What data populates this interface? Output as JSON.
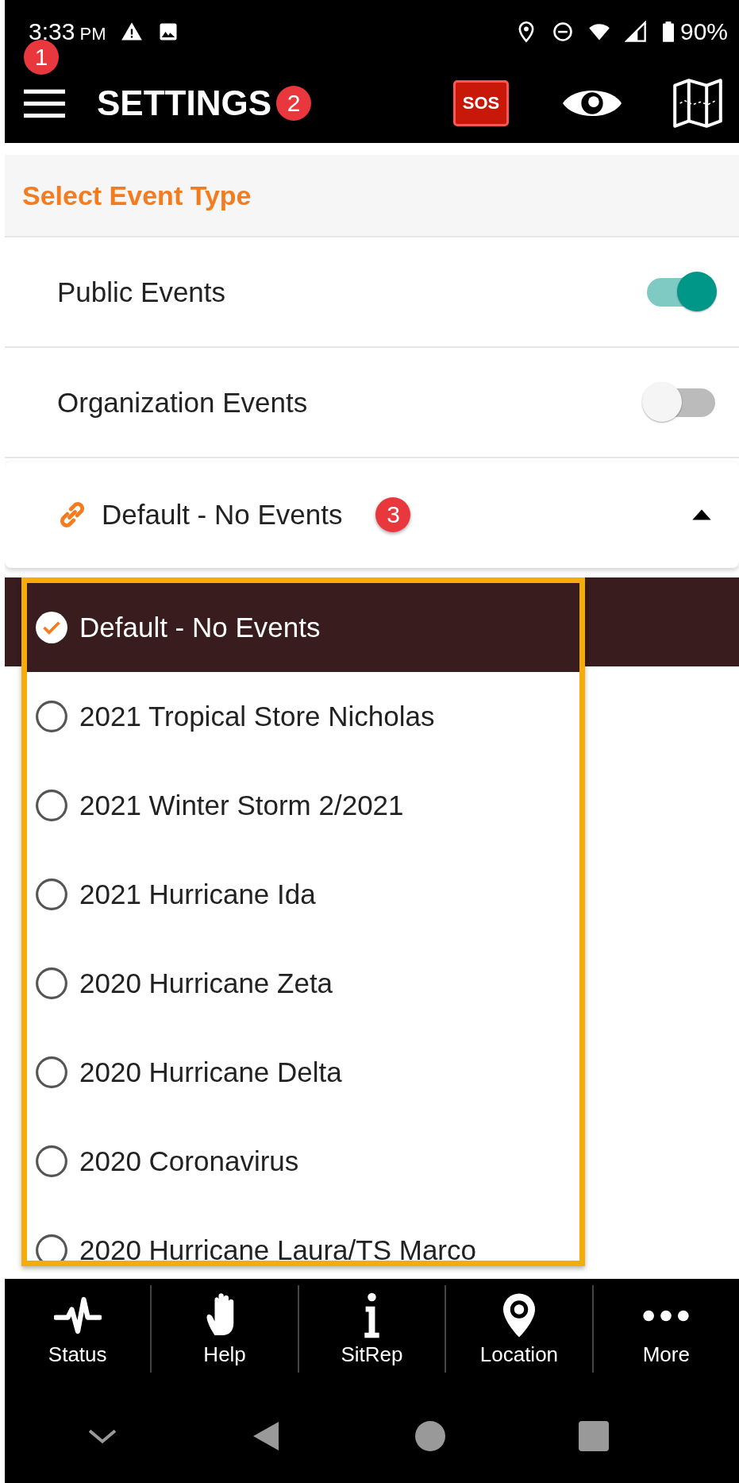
{
  "status_bar": {
    "time": "3:33",
    "ampm": "PM",
    "battery": "90%"
  },
  "app_bar": {
    "title": "SETTINGS",
    "sos": "SOS",
    "menu_badge": "1",
    "title_badge": "2"
  },
  "section": {
    "title": "Select Event Type"
  },
  "toggles": [
    {
      "label": "Public Events",
      "on": true
    },
    {
      "label": "Organization Events",
      "on": false
    }
  ],
  "dropdown": {
    "value": "Default - No Events",
    "badge": "3",
    "expanded": true
  },
  "options": [
    {
      "label": "Default - No Events",
      "selected": true
    },
    {
      "label": "2021 Tropical Store Nicholas",
      "selected": false
    },
    {
      "label": "2021 Winter Storm 2/2021",
      "selected": false
    },
    {
      "label": "2021 Hurricane Ida",
      "selected": false
    },
    {
      "label": "2020 Hurricane Zeta",
      "selected": false
    },
    {
      "label": "2020 Hurricane Delta",
      "selected": false
    },
    {
      "label": "2020 Coronavirus",
      "selected": false
    },
    {
      "label": "2020 Hurricane Laura/TS Marco",
      "selected": false
    }
  ],
  "bottom_nav": [
    {
      "label": "Status",
      "kind": "pulse"
    },
    {
      "label": "Help",
      "kind": "hand"
    },
    {
      "label": "SitRep",
      "kind": "info"
    },
    {
      "label": "Location",
      "kind": "pin"
    },
    {
      "label": "More",
      "kind": "dots"
    }
  ]
}
